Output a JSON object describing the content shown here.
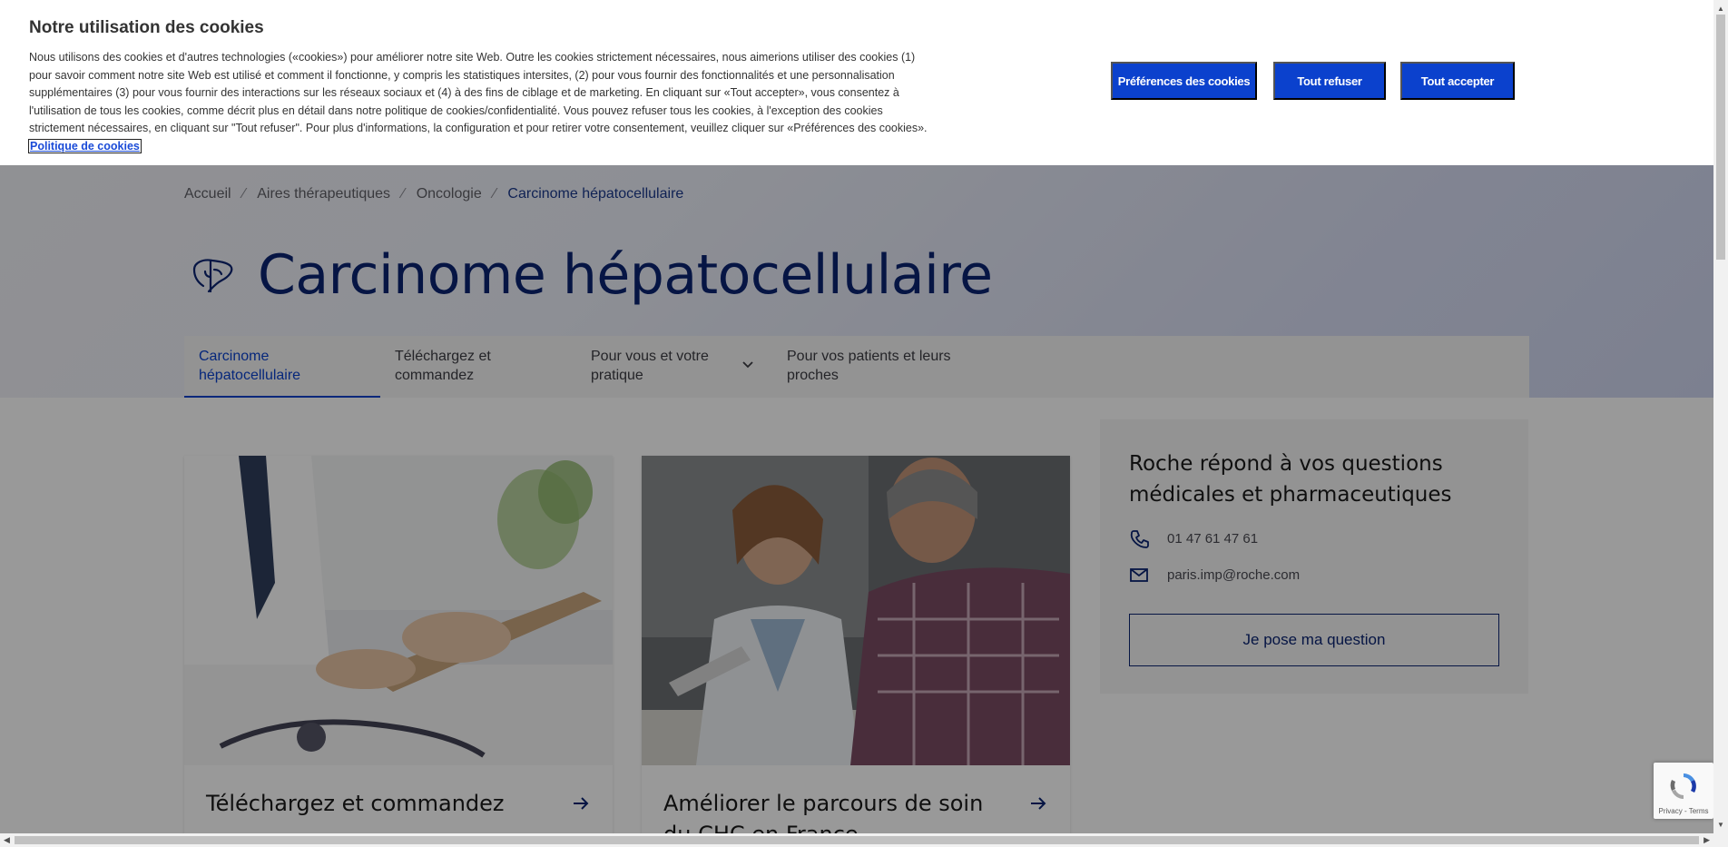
{
  "cookie_banner": {
    "title": "Notre utilisation des cookies",
    "text": "Nous utilisons des cookies et d'autres technologies («cookies») pour améliorer notre site Web. Outre les cookies strictement nécessaires, nous aimerions utiliser des cookies (1) pour savoir comment notre site Web est utilisé et comment il fonctionne, y compris les statistiques intersites, (2) pour vous fournir des fonctionnalités et une personnalisation supplémentaires (3) pour vous fournir des interactions sur les réseaux sociaux et (4) à des fins de ciblage et de marketing. En cliquant sur «Tout accepter», vous consentez à l'utilisation de tous les cookies, comme décrit plus en détail dans notre politique de cookies/confidentialité. Vous pouvez refuser tous les cookies, à l'exception des cookies strictement nécessaires, en cliquant sur \"Tout refuser\". Pour plus d'informations, la configuration et pour retirer votre consentement, veuillez cliquer sur «Préférences des cookies».",
    "policy_link": "Politique de cookies",
    "btn_preferences": "Préférences des cookies",
    "btn_refuse": "Tout refuser",
    "btn_accept": "Tout accepter",
    "accent_color": "#0b41cd"
  },
  "breadcrumb": {
    "items": [
      "Accueil",
      "Aires thérapeutiques",
      "Oncologie",
      "Carcinome hépatocellulaire"
    ],
    "separator": "⁄"
  },
  "page_title": "Carcinome hépatocellulaire",
  "tabs": [
    {
      "label": "Carcinome hépatocellulaire",
      "active": true
    },
    {
      "label": "Téléchargez et commandez",
      "active": false
    },
    {
      "label": "Pour vous et votre pratique",
      "active": false,
      "has_dropdown": true
    },
    {
      "label": "Pour vos patients et leurs proches",
      "active": false
    }
  ],
  "cards": [
    {
      "title": "Téléchargez et commandez",
      "icon": "arrow-right-icon"
    },
    {
      "title": "Améliorer le parcours de soin du CHC en France",
      "icon": "arrow-right-icon"
    }
  ],
  "contact": {
    "heading": "Roche répond à vos questions médicales et pharmaceutiques",
    "phone": "01 47 61 47 61",
    "email": "paris.imp@roche.com",
    "button": "Je pose ma question"
  },
  "recaptcha": {
    "label": "Privacy - Terms"
  }
}
